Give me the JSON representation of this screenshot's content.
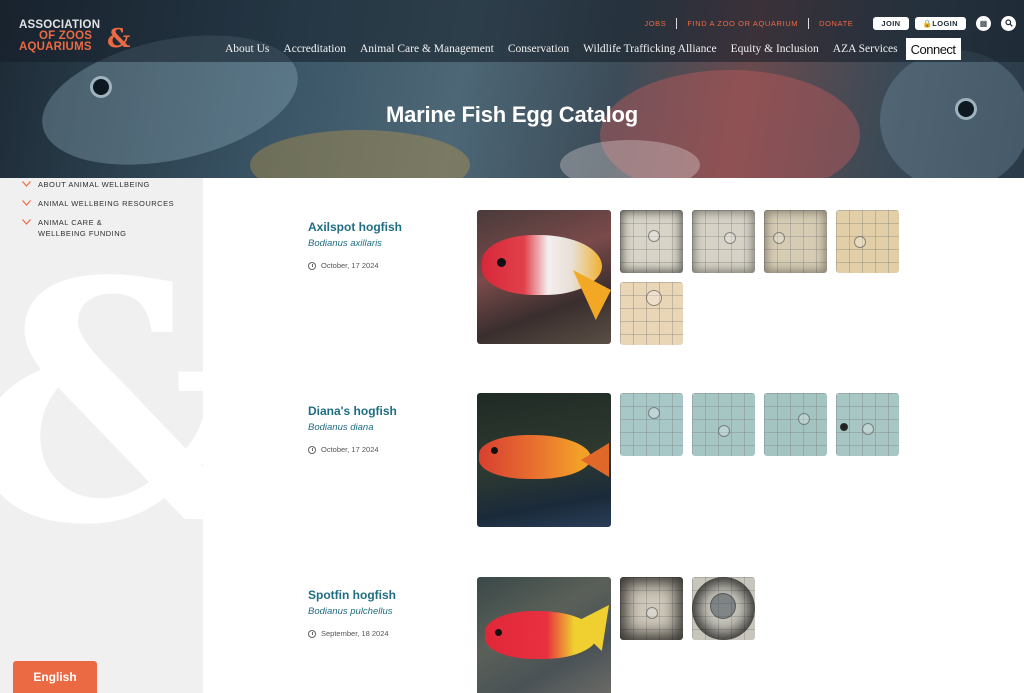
{
  "header": {
    "logo_lines": [
      "ASSOCIATION",
      "OF ZOOS",
      "AQUARIUMS"
    ],
    "logo_amp": "&",
    "utility_links": [
      "JOBS",
      "FIND A ZOO OR AQUARIUM",
      "DONATE"
    ],
    "join_label": "JOIN",
    "login_label": "🔒LOGIN",
    "nav": [
      "About Us",
      "Accreditation",
      "Animal Care & Management",
      "Conservation",
      "Wildlife Trafficking Alliance",
      "Equity & Inclusion",
      "AZA Services"
    ],
    "connect_label": "Connect"
  },
  "hero": {
    "title": "Marine Fish Egg Catalog"
  },
  "sidebar": {
    "items": [
      "ABOUT ANIMAL WELLBEING",
      "ANIMAL WELLBEING RESOURCES",
      "ANIMAL CARE & WELLBEING FUNDING"
    ]
  },
  "entries": [
    {
      "common": "Axilspot hogfish",
      "scientific": "Bodianus axillaris",
      "date": "October, 17 2024",
      "egg_images": 5
    },
    {
      "common": "Diana's hogfish",
      "scientific": "Bodianus diana",
      "date": "October, 17 2024",
      "egg_images": 4
    },
    {
      "common": "Spotfin hogfish",
      "scientific": "Bodianus pulchellus",
      "date": "September, 18 2024",
      "egg_images": 2
    }
  ],
  "language_button": "English",
  "colors": {
    "accent": "#ec6a43",
    "teal": "#1f6d83",
    "sidebar": "#f1f0f0"
  }
}
